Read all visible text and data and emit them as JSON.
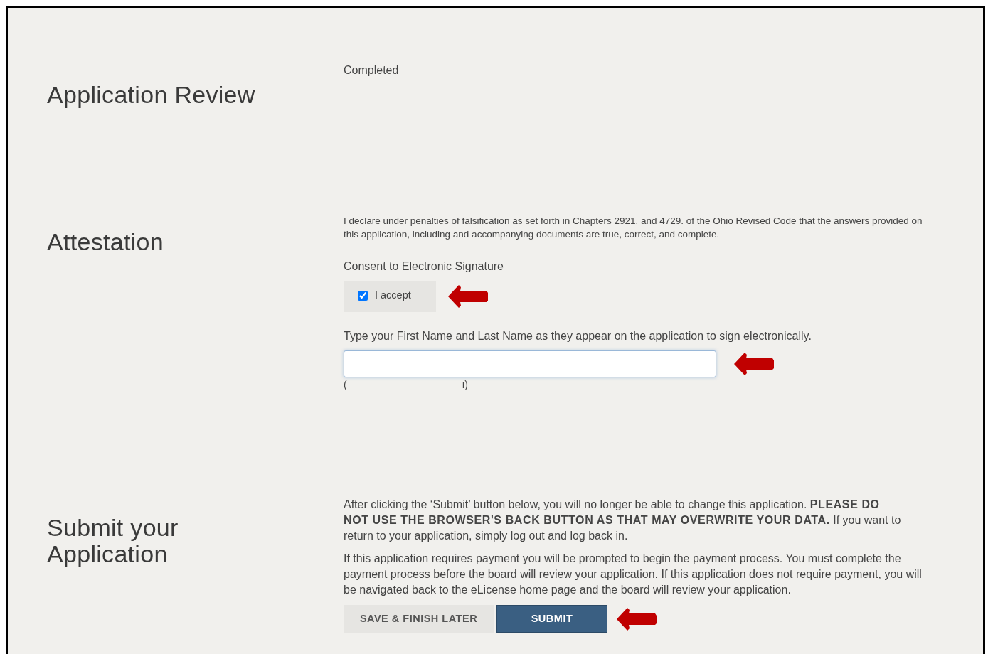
{
  "sections": [
    {
      "kind": "review",
      "title": "Application Review",
      "status": "Completed"
    },
    {
      "kind": "attestation",
      "title": "Attestation",
      "declaration": "I declare under penalties of falsification as set forth in Chapters 2921. and 4729. of the Ohio Revised Code that the answers provided on this application, including and accompanying documents are true, correct, and complete.",
      "consent_label": "Consent to Electronic Signature",
      "checkbox": {
        "label": "I accept",
        "checked": true
      },
      "sign_instruction": "Type your First Name and Last Name as they appear on the application to sign electronically.",
      "name_hint": [
        "(",
        "ı)"
      ]
    },
    {
      "kind": "submit",
      "title": "Submit your Application",
      "paragraphs": [
        "After clicking the ‘Submit’ button below, you will no longer be able to change this application. **PLEASE DO NOT USE THE BROWSER'S BACK BUTTON AS THAT MAY OVERWRITE YOUR DATA.** If you want to return to your application, simply log out and log back in.",
        "If this application requires payment you will be prompted to begin the payment process. You must complete the payment process before the board will review your application. If this application does not require payment, you will be navigated back to the eLicense home page and the board will review your application."
      ],
      "buttons": [
        {
          "label": "SAVE & FINISH LATER",
          "kind": "secondary"
        },
        {
          "label": "SUBMIT",
          "kind": "primary"
        }
      ]
    }
  ]
}
